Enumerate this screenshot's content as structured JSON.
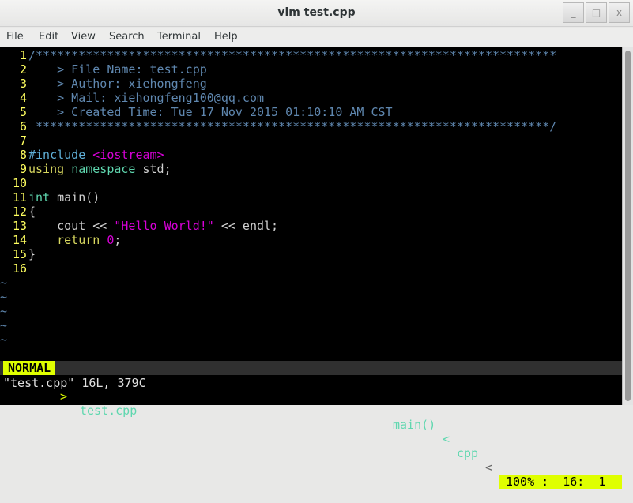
{
  "window": {
    "title": "vim test.cpp",
    "buttons": [
      "minimize",
      "maximize",
      "close"
    ]
  },
  "menu": [
    "File",
    "Edit",
    "View",
    "Search",
    "Terminal",
    "Help"
  ],
  "colors": {
    "linenr": "#ffff5f",
    "comment": "#5f87af",
    "preproc": "#5fafd7",
    "string": "#d700d7",
    "keyword": "#d7d75f",
    "type": "#5fd7af",
    "normal": "#d0d0d0",
    "mode_bg": "#dfff00"
  },
  "lines": [
    {
      "n": "1",
      "t": [
        {
          "c": "comment",
          "s": "/*************************************************************************"
        }
      ]
    },
    {
      "n": "2",
      "t": [
        {
          "c": "comment",
          "s": "    > File Name: test.cpp"
        }
      ]
    },
    {
      "n": "3",
      "t": [
        {
          "c": "comment",
          "s": "    > Author: xiehongfeng"
        }
      ]
    },
    {
      "n": "4",
      "t": [
        {
          "c": "comment",
          "s": "    > Mail: xiehongfeng100@qq.com"
        }
      ]
    },
    {
      "n": "5",
      "t": [
        {
          "c": "comment",
          "s": "    > Created Time: Tue 17 Nov 2015 01:10:10 AM CST"
        }
      ]
    },
    {
      "n": "6",
      "t": [
        {
          "c": "comment",
          "s": " ************************************************************************/"
        }
      ]
    },
    {
      "n": "7",
      "t": []
    },
    {
      "n": "8",
      "t": [
        {
          "c": "preproc",
          "s": "#include "
        },
        {
          "c": "string",
          "s": "<iostream>"
        }
      ]
    },
    {
      "n": "9",
      "t": [
        {
          "c": "keyword",
          "s": "using "
        },
        {
          "c": "type",
          "s": "namespace"
        },
        {
          "c": "normal",
          "s": " std;"
        }
      ]
    },
    {
      "n": "10",
      "t": []
    },
    {
      "n": "11",
      "t": [
        {
          "c": "type",
          "s": "int"
        },
        {
          "c": "normal",
          "s": " main()"
        }
      ]
    },
    {
      "n": "12",
      "t": [
        {
          "c": "normal",
          "s": "{"
        }
      ]
    },
    {
      "n": "13",
      "t": [
        {
          "c": "normal",
          "s": "    cout << "
        },
        {
          "c": "string",
          "s": "\"Hello World!\""
        },
        {
          "c": "normal",
          "s": " << endl;"
        }
      ]
    },
    {
      "n": "14",
      "t": [
        {
          "c": "normal",
          "s": "    "
        },
        {
          "c": "keyword",
          "s": "return "
        },
        {
          "c": "string",
          "s": "0"
        },
        {
          "c": "normal",
          "s": ";"
        }
      ]
    },
    {
      "n": "15",
      "t": [
        {
          "c": "normal",
          "s": "}"
        }
      ]
    },
    {
      "n": "16",
      "t": []
    }
  ],
  "tildes": [
    "~",
    "~",
    "~",
    "~",
    "~"
  ],
  "status": {
    "mode": "NORMAL",
    "sep1": ">",
    "file": "test.cpp",
    "func": "main()",
    "sep2": "<",
    "ft": "cpp",
    "sep3": "<",
    "percent": "100%",
    "pos": ":  16:  1"
  },
  "message": "\"test.cpp\" 16L, 379C"
}
